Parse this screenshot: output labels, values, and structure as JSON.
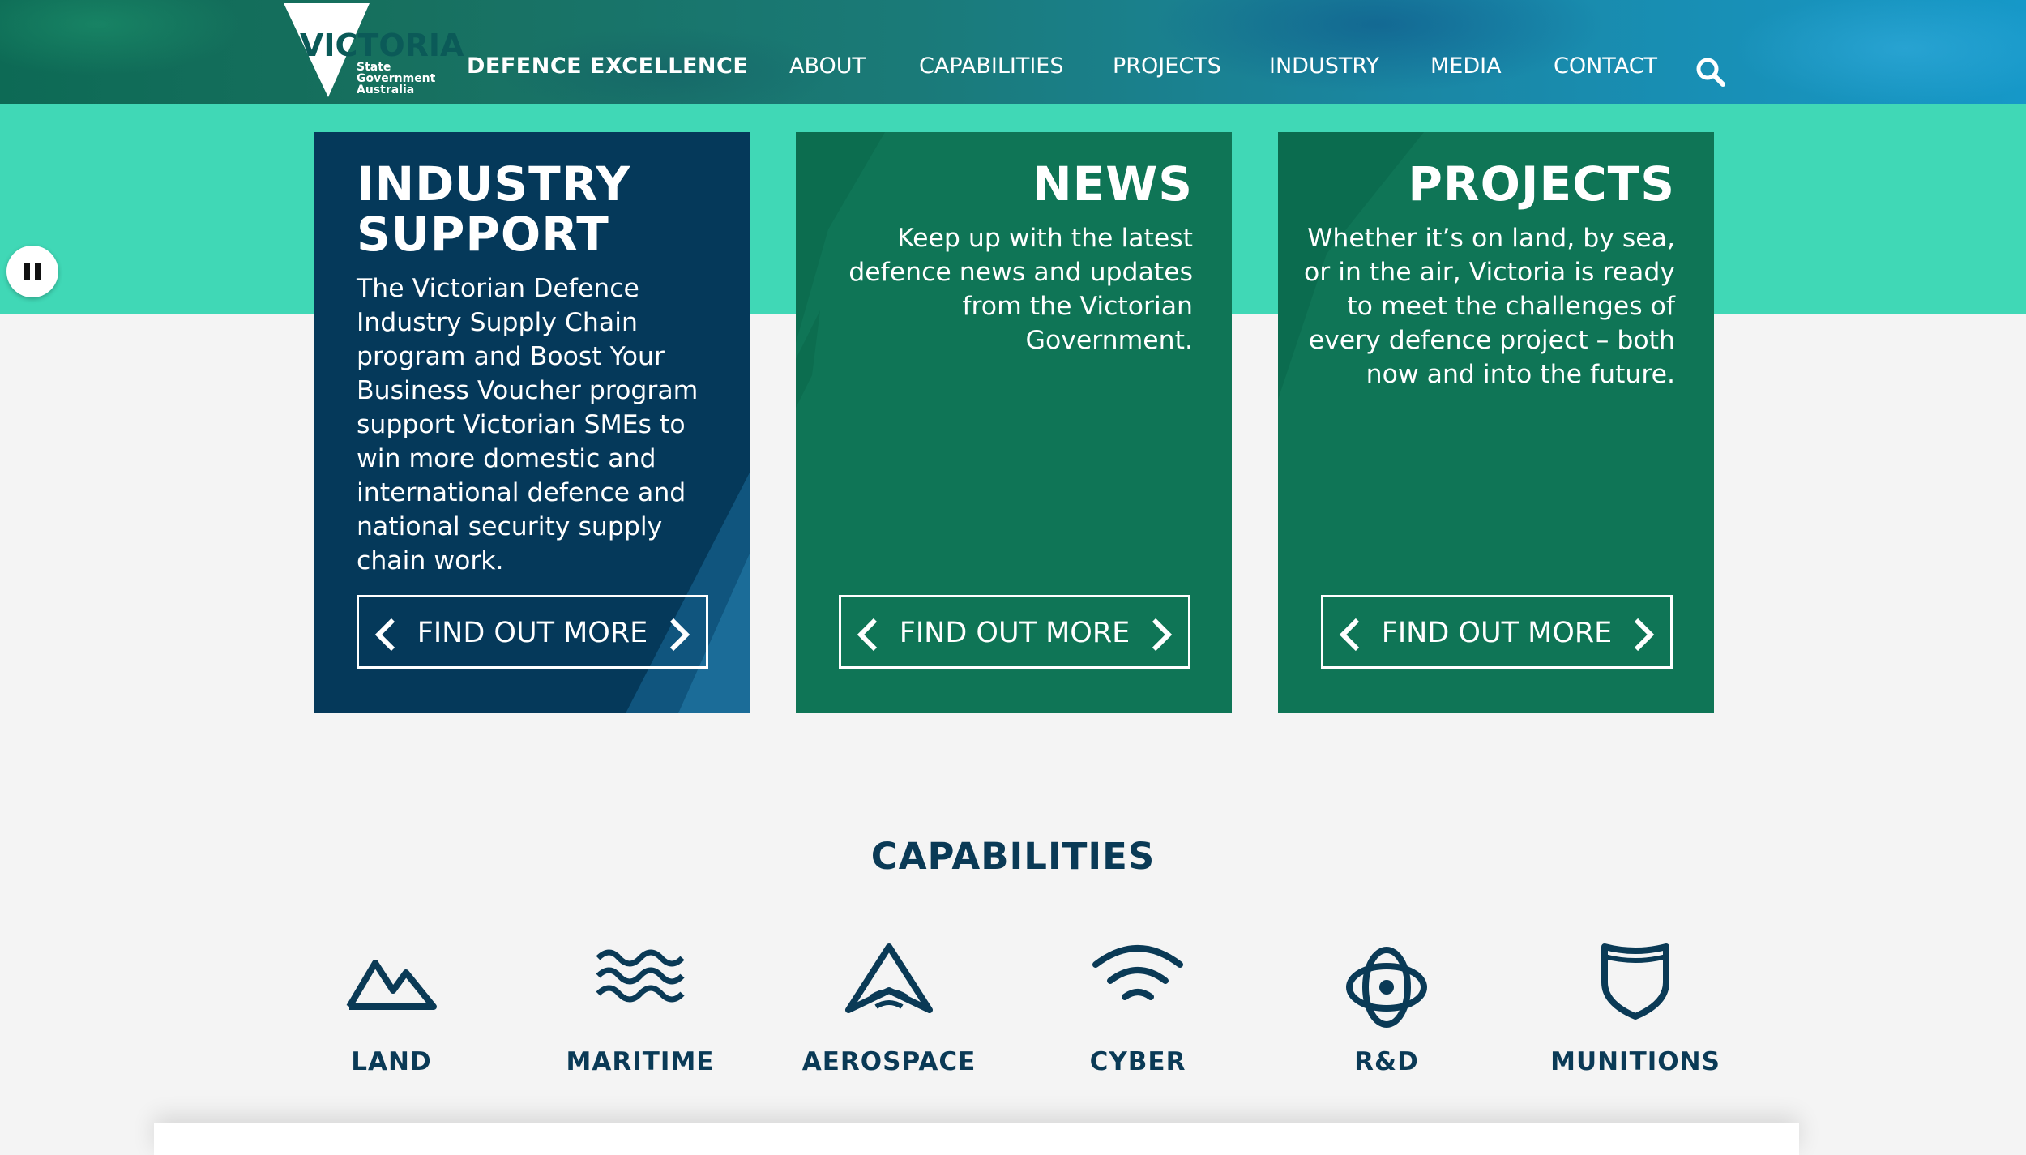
{
  "header": {
    "logo": {
      "word": "VICTORIA",
      "sub": [
        "State",
        "Government",
        "Australia"
      ]
    },
    "brand": "DEFENCE EXCELLENCE",
    "nav": [
      "ABOUT",
      "CAPABILITIES",
      "PROJECTS",
      "INDUSTRY",
      "MEDIA",
      "CONTACT"
    ],
    "search_icon": "search-icon"
  },
  "colors": {
    "band": "#40d8b6",
    "industry_card": "#05395a",
    "green_card": "#0f7556",
    "heading": "#0a3a56"
  },
  "cards": [
    {
      "title_lines": [
        "INDUSTRY",
        "SUPPORT"
      ],
      "body_lines": [
        "The Victorian Defence",
        "Industry Supply Chain",
        "program and Boost Your",
        "Business Voucher program",
        "support Victorian SMEs to",
        "win more domestic and",
        "international defence and",
        "national security supply",
        "chain work."
      ],
      "button": "FIND OUT MORE"
    },
    {
      "title_lines": [
        "NEWS"
      ],
      "body_lines": [
        "Keep up with the latest",
        "defence news and updates",
        "from the Victorian",
        "Government."
      ],
      "button": "FIND OUT MORE"
    },
    {
      "title_lines": [
        "PROJECTS"
      ],
      "body_lines": [
        "Whether it’s on land, by sea,",
        "or in the air, Victoria is ready",
        "to meet the challenges of",
        "every defence project – both",
        "now and into the future."
      ],
      "button": "FIND OUT MORE"
    }
  ],
  "capabilities": {
    "title": "CAPABILITIES",
    "items": [
      {
        "label": "LAND",
        "icon": "mountain-icon"
      },
      {
        "label": "MARITIME",
        "icon": "waves-icon"
      },
      {
        "label": "AEROSPACE",
        "icon": "aircraft-icon"
      },
      {
        "label": "CYBER",
        "icon": "wifi-icon"
      },
      {
        "label": "R&D",
        "icon": "atom-icon"
      },
      {
        "label": "MUNITIONS",
        "icon": "shield-icon"
      }
    ]
  },
  "slider": {
    "control_icon": "pause-icon"
  }
}
